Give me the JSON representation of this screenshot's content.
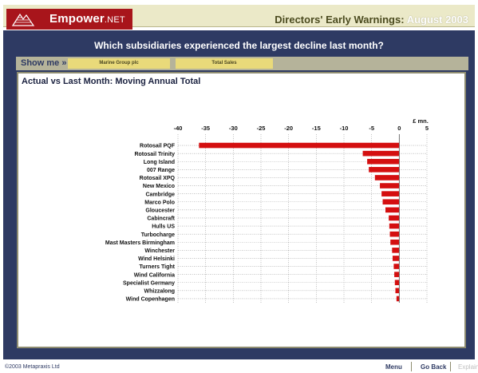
{
  "header": {
    "brand": "Empower",
    "brand_suffix": ".NET",
    "title": "Directors' Early Warnings:",
    "title_period": "August 2003"
  },
  "question": "Which subsidiaries experienced the largest decline last month?",
  "show_me": {
    "label": "Show me »",
    "group": "Marine Group plc",
    "measure": "Total Sales"
  },
  "panel": {
    "title": "Actual vs Last Month: Moving Annual Total"
  },
  "footer": {
    "copyright": "©2003 Metapraxis Ltd",
    "menu": "Menu",
    "go_back": "Go Back",
    "explain": "Explain"
  },
  "colors": {
    "bar": "#d40f10",
    "frame": "#2e3a63",
    "header": "#ebe9c8",
    "brand": "#a8151b"
  },
  "chart_data": {
    "type": "bar",
    "orientation": "horizontal",
    "unit_label": "£ mn.",
    "xlim": [
      -40,
      5
    ],
    "xticks": [
      -40,
      -35,
      -30,
      -25,
      -20,
      -15,
      -10,
      -5,
      0,
      5
    ],
    "grid": true,
    "categories": [
      "Rotosail PQF",
      "Rotosail Trinity",
      "Long Island",
      "007 Range",
      "Rotosail XPQ",
      "New Mexico",
      "Cambridge",
      "Marco Polo",
      "Gloucester",
      "Cabincraft",
      "Hulls US",
      "Turbocharge",
      "Mast Masters Birmingham",
      "Winchester",
      "Wind Helsinki",
      "Turners Tight",
      "Wind California",
      "Specialist Germany",
      "Whizzalong",
      "Wind Copenhagen"
    ],
    "values": [
      -36.2,
      -6.6,
      -5.8,
      -5.5,
      -4.4,
      -3.5,
      -3.2,
      -3.0,
      -2.5,
      -1.9,
      -1.8,
      -1.7,
      -1.6,
      -1.3,
      -1.2,
      -1.0,
      -0.9,
      -0.8,
      -0.7,
      -0.5
    ]
  }
}
